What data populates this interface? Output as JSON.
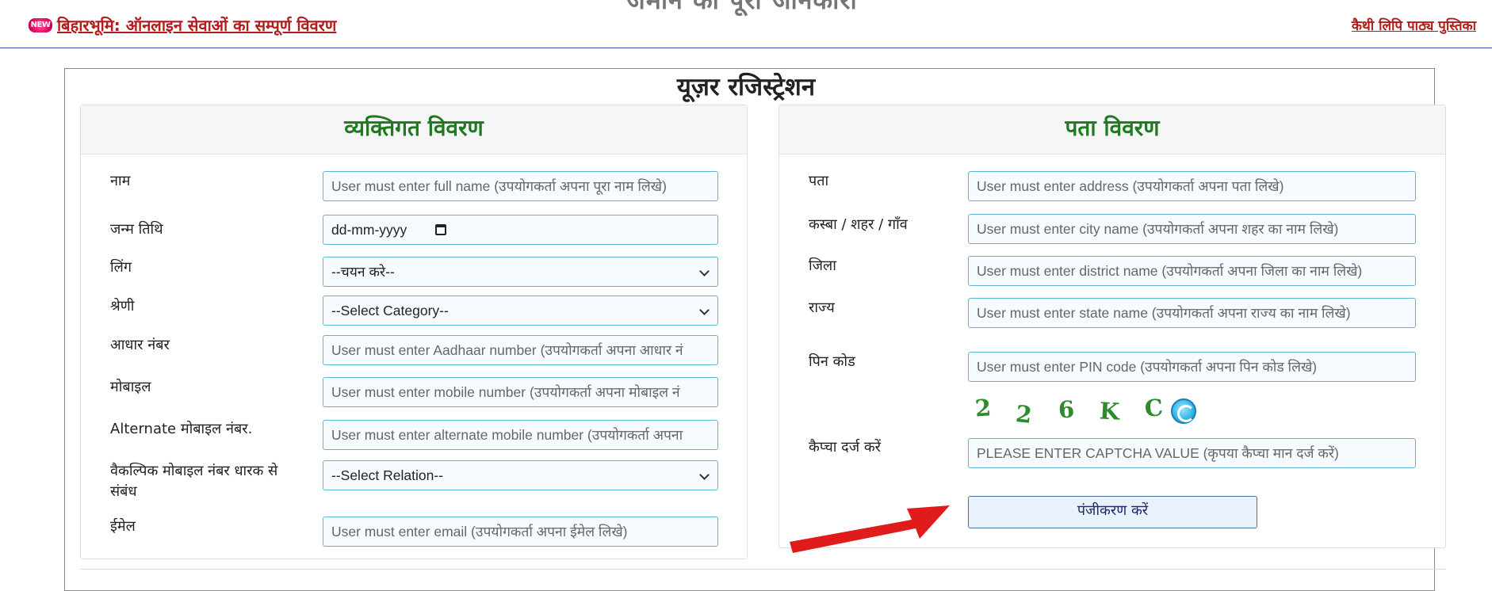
{
  "header": {
    "new_badge": "NEW",
    "left_link": "बिहारभूमि: ऑनलाइन सेवाओं का सम्पूर्ण विवरण",
    "right_link": "कैथी लिपि पाठ्य पुस्तिका",
    "cut_title": "जमीन की पूरी जानकारी"
  },
  "page_title": "यूज़र रजिस्ट्रेशन",
  "personal": {
    "heading": "व्यक्तिगत विवरण",
    "name_label": "नाम",
    "name_placeholder": "User must enter full name (उपयोगकर्ता अपना पूरा नाम लिखे)",
    "dob_label": "जन्म तिथि",
    "dob_value": "dd-mm-yyyy",
    "gender_label": "लिंग",
    "gender_value": "--चयन करे--",
    "category_label": "श्रेणी",
    "category_value": "--Select Category--",
    "aadhaar_label": "आधार नंबर",
    "aadhaar_placeholder": "User must enter Aadhaar number (उपयोगकर्ता अपना आधार नं",
    "mobile_label": "मोबाइल",
    "mobile_placeholder": "User must enter mobile number (उपयोगकर्ता अपना मोबाइल नं",
    "alt_mobile_label": "Alternate मोबाइल नंबर.",
    "alt_mobile_placeholder": "User must enter alternate mobile number (उपयोगकर्ता अपना",
    "relation_label": "वैकल्पिक मोबाइल नंबर धारक से संबंध",
    "relation_value": "--Select Relation--",
    "email_label": "ईमेल",
    "email_placeholder": "User must enter email (उपयोगकर्ता अपना ईमेल लिखे)"
  },
  "address": {
    "heading": "पता विवरण",
    "address_label": "पता",
    "address_placeholder": "User must enter address (उपयोगकर्ता अपना पता लिखे)",
    "city_label": "कस्बा / शहर / गाँव",
    "city_placeholder": "User must enter city name (उपयोगकर्ता अपना शहर का नाम लिखे)",
    "district_label": "जिला",
    "district_placeholder": "User must enter district name (उपयोगकर्ता अपना जिला का नाम लिखे)",
    "state_label": "राज्य",
    "state_placeholder": "User must enter state name (उपयोगकर्ता अपना राज्य का नाम लिखे)",
    "pin_label": "पिन कोड",
    "pin_placeholder": "User must enter PIN code (उपयोगकर्ता अपना पिन कोड लिखे)",
    "captcha_chars": [
      "2",
      "2",
      "6",
      "K",
      "C"
    ],
    "captcha_label": "कैप्चा दर्ज करें",
    "captcha_placeholder": "PLEASE ENTER CAPTCHA VALUE (कृपया कैप्चा मान दर्ज करें)",
    "submit_label": "पंजीकरण करें"
  },
  "icons": {
    "refresh": "refresh-icon",
    "calendar": "calendar-icon",
    "arrow": "red-arrow-icon"
  },
  "colors": {
    "heading_green": "#1f7a1f",
    "link_red": "#b21c1c",
    "field_border": "#5bb8d4",
    "arrow_red": "#e01b1b"
  }
}
